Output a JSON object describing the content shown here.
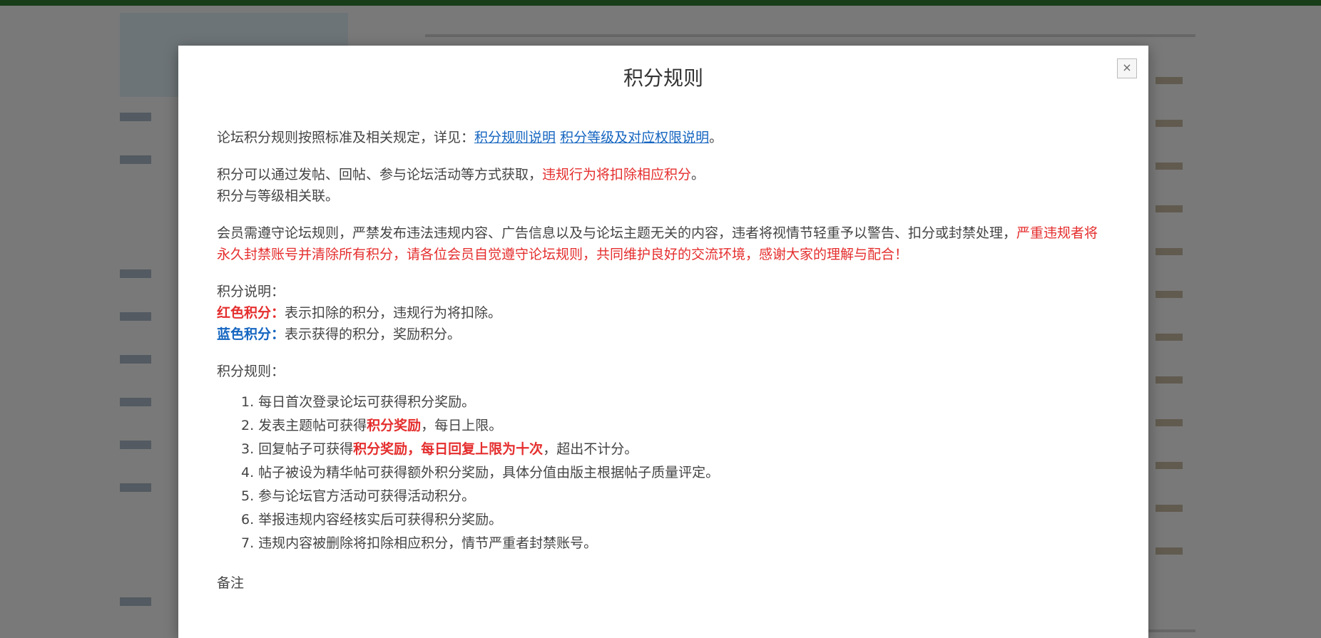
{
  "modal": {
    "title": "积分规则",
    "close_icon": "×"
  },
  "content": {
    "line1_prefix": "论坛积分规则按照标准及相关规定，详见：",
    "line1_link1": "积分规则说明",
    "line1_link2": "积分等级及对应权限说明",
    "line1_suffix": "。",
    "line2_prefix": "积分可以通过发帖、回帖、参与论坛活动等方式获取，",
    "line2_red": "违规行为将扣除相应积分",
    "line2_suffix": "。",
    "line3": "积分与等级相关联。",
    "para2_normal": "会员需遵守论坛规则，严禁发布违法违规内容、广告信息以及与论坛主题无关的内容，违者将视情节轻重予以警告、扣分或封禁处理，",
    "para2_red": "严重违规者将永久封禁账号并清除所有积分，请各位会员自觉遵守论坛规则，共同维护良好的交流环境，感谢大家的理解与配合！",
    "status_title": "积分说明：",
    "status_red_label": "红色积分：",
    "status_red_text": "表示扣除的积分，违规行为将扣除。",
    "status_blue_label": "蓝色积分：",
    "status_blue_text": "表示获得的积分，奖励积分。",
    "rules_title": "积分规则：",
    "rules": [
      {
        "prefix": "1. 每日首次登录论坛可获得积分奖励。",
        "red": "",
        "suffix": ""
      },
      {
        "prefix": "2. 发表主题帖可获得",
        "red": "积分奖励",
        "suffix": "，每日上限。"
      },
      {
        "prefix": "3. 回复帖子可获得",
        "red": "积分奖励，每日回复上限为十次",
        "suffix": "，超出不计分。"
      },
      {
        "prefix": "4. 帖子被设为精华帖可获得额外积分奖励，具体分值由版主根据帖子质量评定。",
        "red": "",
        "suffix": ""
      },
      {
        "prefix": "5. 参与论坛官方活动可获得活动积分。",
        "red": "",
        "suffix": ""
      },
      {
        "prefix": "6. 举报违规内容经核实后可获得积分奖励。",
        "red": "",
        "suffix": ""
      },
      {
        "prefix": "7. 违规内容被删除将扣除相应积分，情节严重者封禁账号。",
        "red": "",
        "suffix": ""
      }
    ],
    "footer": "备注"
  }
}
